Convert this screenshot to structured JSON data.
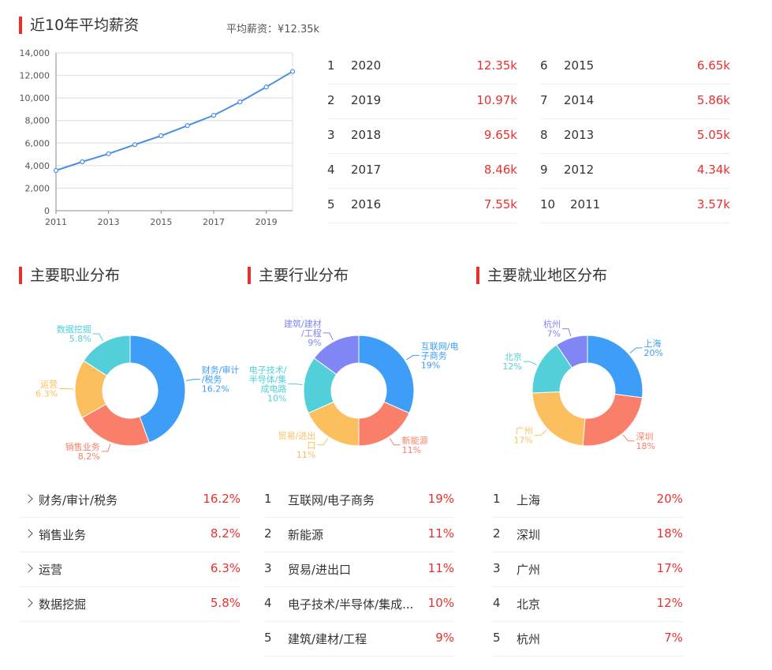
{
  "salary": {
    "title": "近10年平均薪资",
    "average_text": "平均薪资：¥12.35k",
    "ranking": [
      {
        "rank": "1",
        "year": "2020",
        "value": "12.35k"
      },
      {
        "rank": "2",
        "year": "2019",
        "value": "10.97k"
      },
      {
        "rank": "3",
        "year": "2018",
        "value": "9.65k"
      },
      {
        "rank": "4",
        "year": "2017",
        "value": "8.46k"
      },
      {
        "rank": "5",
        "year": "2016",
        "value": "7.55k"
      },
      {
        "rank": "6",
        "year": "2015",
        "value": "6.65k"
      },
      {
        "rank": "7",
        "year": "2014",
        "value": "5.86k"
      },
      {
        "rank": "8",
        "year": "2013",
        "value": "5.05k"
      },
      {
        "rank": "9",
        "year": "2012",
        "value": "4.34k"
      },
      {
        "rank": "10",
        "year": "2011",
        "value": "3.57k"
      }
    ]
  },
  "occupation": {
    "title": "主要职业分布",
    "list": [
      {
        "name": "财务/审计/税务",
        "value": "16.2%"
      },
      {
        "name": "销售业务",
        "value": "8.2%"
      },
      {
        "name": "运营",
        "value": "6.3%"
      },
      {
        "name": "数据挖掘",
        "value": "5.8%"
      }
    ]
  },
  "industry": {
    "title": "主要行业分布",
    "list": [
      {
        "rank": "1",
        "name": "互联网/电子商务",
        "value": "19%"
      },
      {
        "rank": "2",
        "name": "新能源",
        "value": "11%"
      },
      {
        "rank": "3",
        "name": "贸易/进出口",
        "value": "11%"
      },
      {
        "rank": "4",
        "name": "电子技术/半导体/集成...",
        "value": "10%"
      },
      {
        "rank": "5",
        "name": "建筑/建材/工程",
        "value": "9%"
      }
    ]
  },
  "region": {
    "title": "主要就业地区分布",
    "list": [
      {
        "rank": "1",
        "name": "上海",
        "value": "20%"
      },
      {
        "rank": "2",
        "name": "深圳",
        "value": "18%"
      },
      {
        "rank": "3",
        "name": "广州",
        "value": "17%"
      },
      {
        "rank": "4",
        "name": "北京",
        "value": "12%"
      },
      {
        "rank": "5",
        "name": "杭州",
        "value": "7%"
      }
    ]
  },
  "chart_data": [
    {
      "type": "line",
      "x": [
        2011,
        2012,
        2013,
        2014,
        2015,
        2016,
        2017,
        2018,
        2019,
        2020
      ],
      "xticks": [
        "2011",
        "2013",
        "2015",
        "2017",
        "2019"
      ],
      "y": [
        3570,
        4340,
        5050,
        5860,
        6650,
        7550,
        8460,
        9650,
        10970,
        12350
      ],
      "yticks": [
        "0",
        "2,000",
        "4,000",
        "6,000",
        "8,000",
        "10,000",
        "12,000",
        "14,000"
      ],
      "ylim": [
        0,
        14000
      ],
      "grid": true,
      "color": "#4a90e2"
    },
    {
      "type": "pie",
      "labels": [
        "财务/审计/税务",
        "销售业务",
        "运营",
        "数据挖掘"
      ],
      "values": [
        16.2,
        8.2,
        6.3,
        5.8
      ],
      "value_labels": [
        "16.2%",
        "8.2%",
        "6.3%",
        "5.8%"
      ],
      "colors": [
        "#3d9df7",
        "#fa7f6a",
        "#fcbf5d",
        "#52cfd9"
      ]
    },
    {
      "type": "pie",
      "labels": [
        "互联网/电子商务",
        "新能源",
        "贸易/进出口",
        "电子技术/半导体/集成电路",
        "建筑/建材/工程"
      ],
      "values": [
        19,
        11,
        11,
        10,
        9
      ],
      "value_labels": [
        "19%",
        "11%",
        "11%",
        "10%",
        "9%"
      ],
      "colors": [
        "#3d9df7",
        "#fa7f6a",
        "#fcbf5d",
        "#52cfd9",
        "#8186f5"
      ]
    },
    {
      "type": "pie",
      "labels": [
        "上海",
        "深圳",
        "广州",
        "北京",
        "杭州"
      ],
      "values": [
        20,
        18,
        17,
        12,
        7
      ],
      "value_labels": [
        "20%",
        "18%",
        "17%",
        "12%",
        "7%"
      ],
      "colors": [
        "#3d9df7",
        "#fa7f6a",
        "#fcbf5d",
        "#52cfd9",
        "#8186f5"
      ]
    }
  ]
}
